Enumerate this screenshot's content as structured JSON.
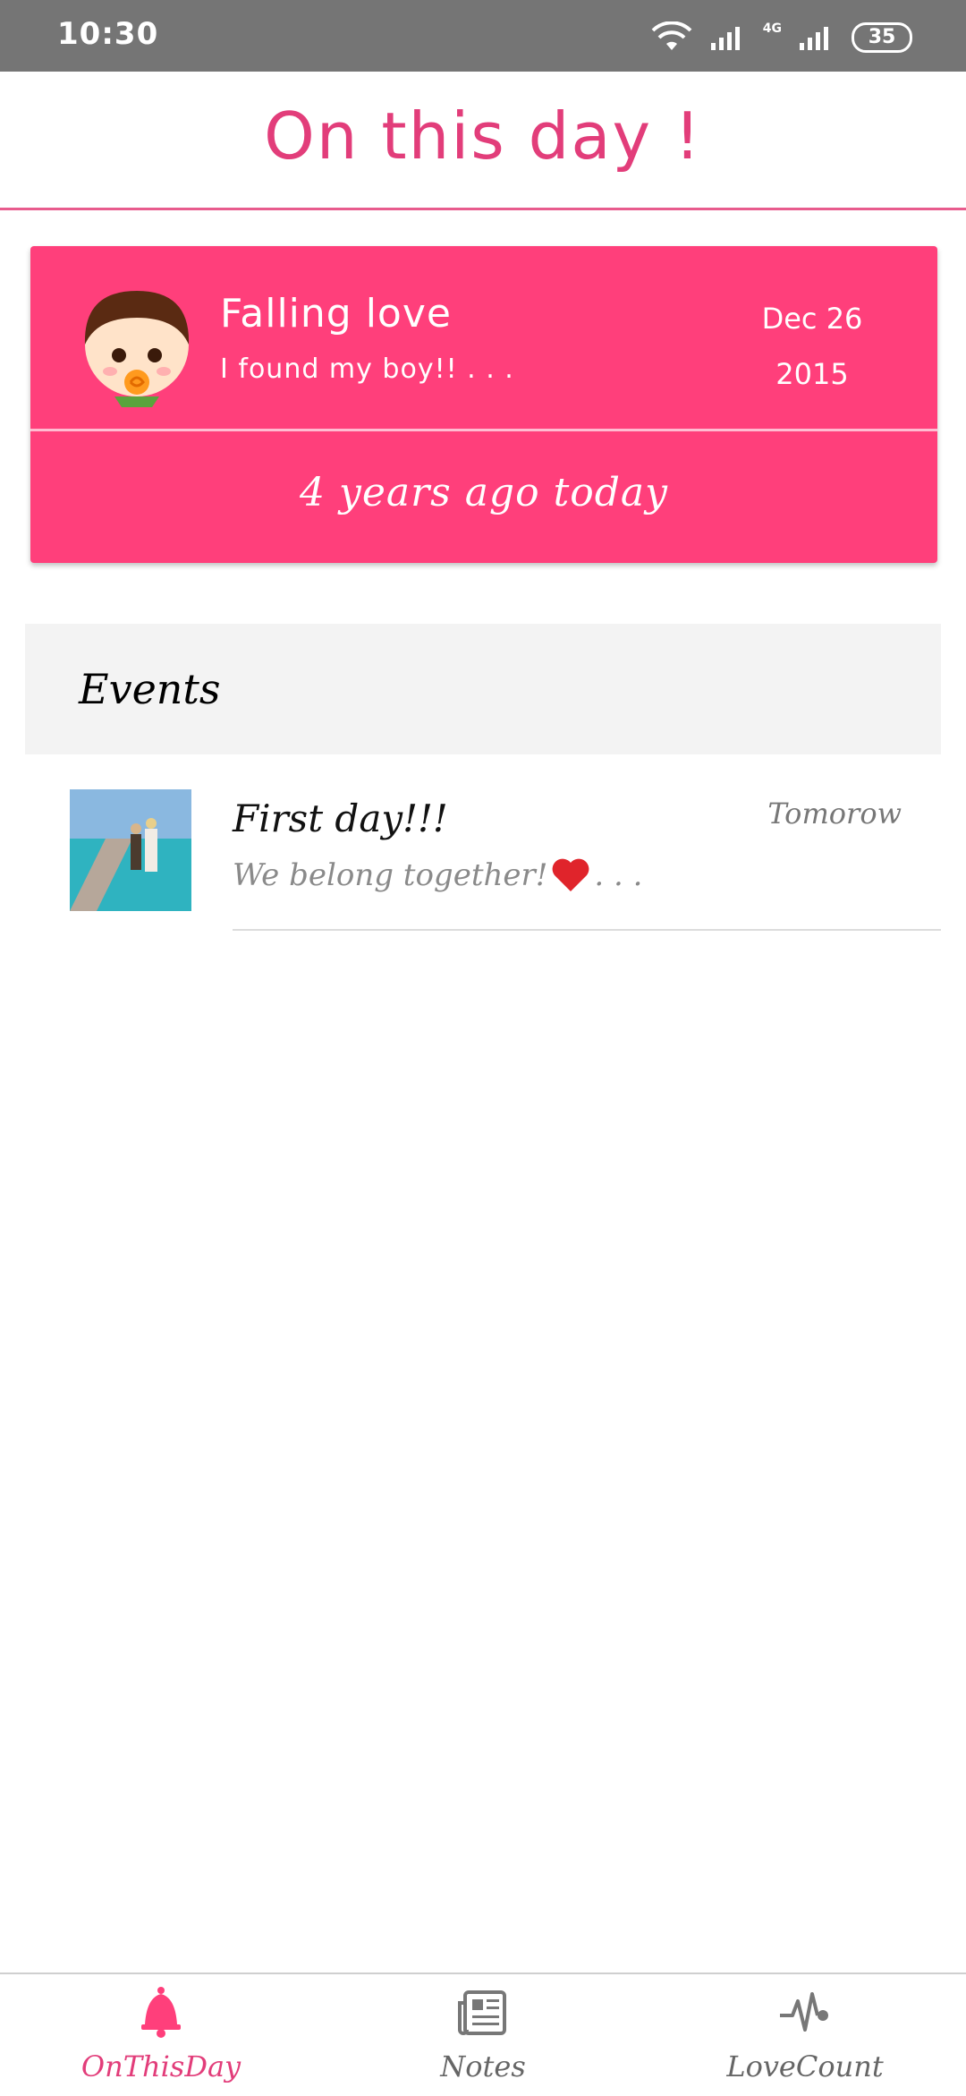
{
  "status_bar": {
    "time": "10:30",
    "network_label": "4G",
    "battery": "35"
  },
  "header": {
    "title": "On this day !"
  },
  "memory_card": {
    "title": "Falling love",
    "subtitle": "I found my boy!! . . .",
    "date_month_day": "Dec 26",
    "date_year": "2015",
    "footer": "4 years ago today",
    "accent_color": "#ff3f7b"
  },
  "events": {
    "label": "Events",
    "items": [
      {
        "title": "First day!!!",
        "time": "Tomorow",
        "description": "We belong together!",
        "ellipsis": ". . ."
      }
    ]
  },
  "bottom_nav": {
    "items": [
      {
        "label": "OnThisDay",
        "icon": "bell-icon",
        "active": true
      },
      {
        "label": "Notes",
        "icon": "newspaper-icon",
        "active": false
      },
      {
        "label": "LoveCount",
        "icon": "heartbeat-icon",
        "active": false
      }
    ],
    "active_color": "#e23d7a"
  }
}
